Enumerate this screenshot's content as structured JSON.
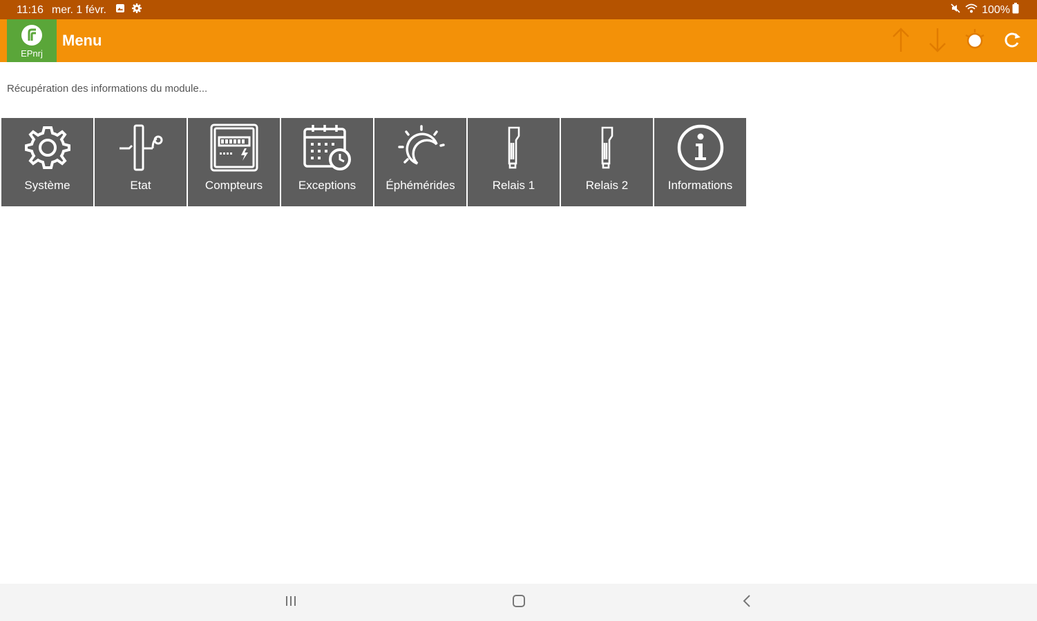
{
  "status_bar": {
    "time": "11:16",
    "date": "mer. 1 févr.",
    "battery": "100%"
  },
  "app_bar": {
    "logo_text": "EPnrj",
    "title": "Menu",
    "actions": [
      "arrow-up-icon",
      "arrow-down-icon",
      "sun-icon",
      "refresh-icon"
    ]
  },
  "main": {
    "status_message": "Récupération des informations du module..."
  },
  "tiles": [
    {
      "label": "Système",
      "icon": "gear-icon"
    },
    {
      "label": "Etat",
      "icon": "switch-state-icon"
    },
    {
      "label": "Compteurs",
      "icon": "meter-icon"
    },
    {
      "label": "Exceptions",
      "icon": "calendar-clock-icon"
    },
    {
      "label": "Éphémérides",
      "icon": "sun-moon-icon"
    },
    {
      "label": "Relais 1",
      "icon": "relay-icon"
    },
    {
      "label": "Relais 2",
      "icon": "relay-icon"
    },
    {
      "label": "Informations",
      "icon": "info-icon"
    }
  ],
  "colors": {
    "status_bar": "#b55300",
    "app_bar": "#f39108",
    "logo_bg": "#5aa639",
    "tile_bg": "#5d5d5d"
  }
}
